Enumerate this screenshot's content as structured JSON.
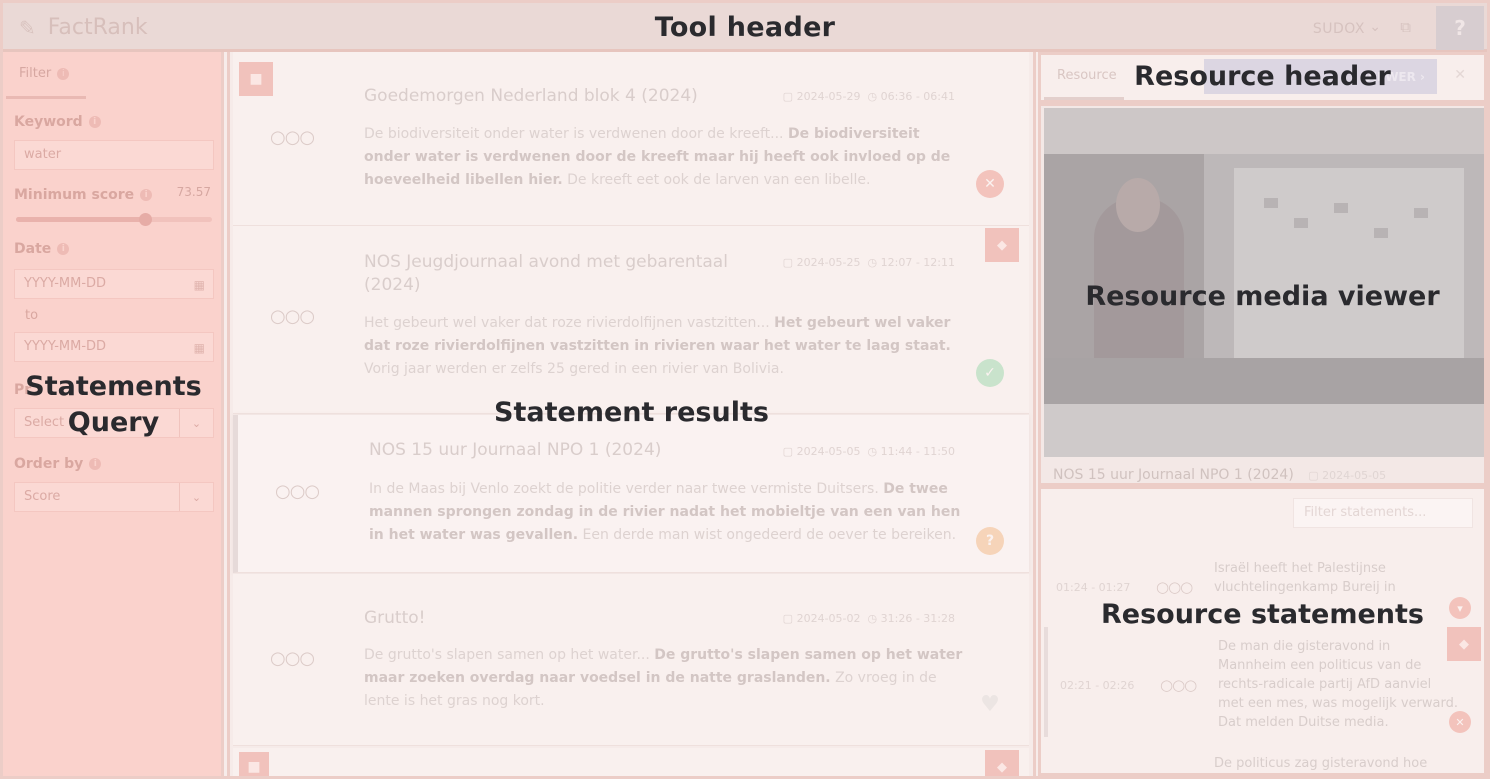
{
  "tool_header": {
    "app_name": "FactRank",
    "user": "SUDOX",
    "overlay_label": "Tool header"
  },
  "query": {
    "tab_label": "Filter",
    "keyword_label": "Keyword",
    "keyword_value": "water",
    "min_score_label": "Minimum score",
    "min_score_value": "73.57",
    "min_score_fraction": 0.66,
    "date_label": "Date",
    "date_from_placeholder": "YYYY-MM-DD",
    "date_to_label": "to",
    "date_to_placeholder": "YYYY-MM-DD",
    "program_label": "Pr",
    "program_placeholder": "Select",
    "order_label": "Order by",
    "order_value": "Score",
    "overlay_label": "Statements Query"
  },
  "results": {
    "overlay_label": "Statement results",
    "cards": [
      {
        "title": "Goedemorgen Nederland blok 4 (2024)",
        "date": "2024-05-29",
        "time": "06:36 - 06:41",
        "dots": "○○○",
        "pre": "De biodiversiteit onder water is verdwenen door de kreeft... ",
        "bold": "De biodiversiteit onder water is verdwenen door de kreeft maar hij heeft ook invloed op de hoeveelheid libellen hier.",
        "post": " De kreeft eet ook de larven van een libelle.",
        "status_icon": "✕"
      },
      {
        "title": "NOS Jeugdjournaal avond met gebarentaal (2024)",
        "date": "2024-05-25",
        "time": "12:07 - 12:11",
        "dots": "○○○",
        "pre": "Het gebeurt wel vaker dat roze rivierdolfijnen vastzitten... ",
        "bold": "Het gebeurt wel vaker dat roze rivierdolfijnen vastzitten in rivieren waar het water te laag staat.",
        "post": " Vorig jaar werden er zelfs 25 gered in een rivier van Bolivia.",
        "status_icon": "✓"
      },
      {
        "title": "NOS 15 uur Journaal NPO 1 (2024)",
        "date": "2024-05-05",
        "time": "11:44 - 11:50",
        "dots": "○○○",
        "pre": "In de Maas bij Venlo zoekt de politie verder naar twee vermiste Duitsers. ",
        "bold": "De twee mannen sprongen zondag in de rivier nadat het mobieltje van een van hen in het water was gevallen.",
        "post": " Een derde man wist ongedeerd de oever te bereiken.",
        "status_icon": "?"
      },
      {
        "title": "Grutto!",
        "date": "2024-05-02",
        "time": "31:26 - 31:28",
        "dots": "○○○",
        "pre": "De grutto's slapen samen op het water... ",
        "bold": "De grutto's slapen samen op het water maar zoeken overdag naar voedsel in de natte graslanden.",
        "post": " Zo vroeg in de lente is het gras nog kort.",
        "status_icon": "♥"
      }
    ]
  },
  "resource": {
    "tab_label": "Resource",
    "button_label": "VIEWER",
    "overlay_label": "Resource header"
  },
  "media": {
    "caption_title": "NOS 15 uur Journaal NPO 1 (2024)",
    "caption_date": "2024-05-05",
    "overlay_label": "Resource media viewer"
  },
  "resource_statements": {
    "filter_placeholder": "Filter statements...",
    "overlay_label": "Resource statements",
    "rows": [
      {
        "time": "01:24 - 01:27",
        "dots": "○○○",
        "text": "Israël heeft het Palestijnse vluchtelingenkamp Bureij in"
      },
      {
        "time": "02:21 - 02:26",
        "dots": "○○○",
        "text": "De man die gisteravond in Mannheim een politicus van de rechts-radicale partij AfD aanviel met een mes, was mogelijk verward. Dat melden Duitse media."
      },
      {
        "time": "",
        "dots": "",
        "text": "De politicus zag gisteravond hoe drie"
      }
    ]
  }
}
